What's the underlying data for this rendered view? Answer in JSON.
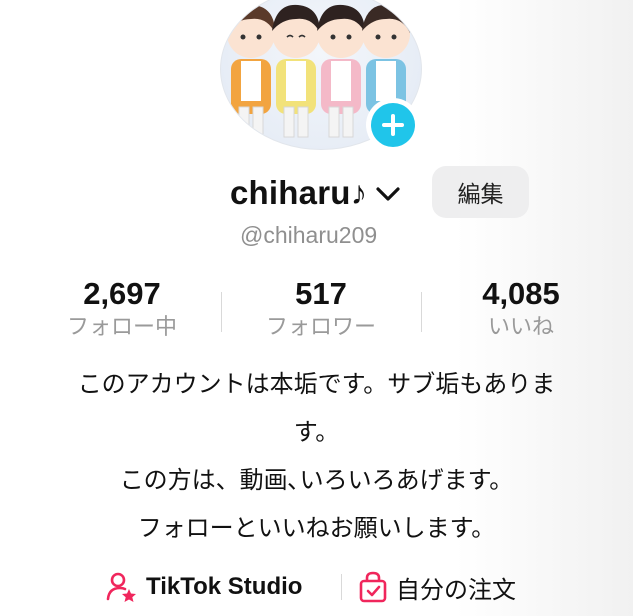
{
  "profile": {
    "username": "chiharu♪",
    "handle": "@chiharu209",
    "edit_label": "編集",
    "accent_color": "#20c5ea"
  },
  "stats": [
    {
      "value": "2,697",
      "label": "フォロー中"
    },
    {
      "value": "517",
      "label": "フォロワー"
    },
    {
      "value": "4,085",
      "label": "いいね"
    }
  ],
  "bio": {
    "lines": [
      "このアカウントは本垢です。サブ垢もありま",
      "す。",
      "この方は、動画､いろいろあげます。",
      "フォローといいねお願いします。"
    ]
  },
  "links": {
    "studio_label": "TikTok Studio",
    "orders_label": "自分の注文",
    "icon_color": "#f0265c"
  },
  "icons": {
    "add": "plus-icon",
    "dropdown": "chevron-down-icon",
    "studio": "person-star-icon",
    "orders": "shopping-bag-icon"
  }
}
